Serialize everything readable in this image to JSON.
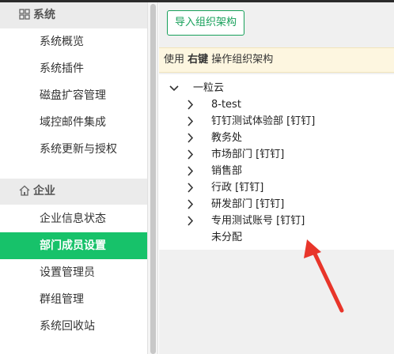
{
  "sidebar": {
    "system": {
      "header": "系统",
      "items": [
        "系统概览",
        "系统插件",
        "磁盘扩容管理",
        "域控邮件集成",
        "系统更新与授权"
      ]
    },
    "enterprise": {
      "header": "企业",
      "items": [
        "企业信息状态",
        "部门成员设置",
        "设置管理员",
        "群组管理",
        "系统回收站"
      ],
      "active_index": 1
    }
  },
  "main": {
    "import_button": "导入组织架构",
    "tip": {
      "prefix": "使用 ",
      "key": "右键",
      "suffix": " 操作组织架构"
    },
    "tree": {
      "root": "一粒云",
      "children": [
        "8-test",
        "钉钉测试体验部 [钉钉]",
        "教务处",
        "市场部门 [钉钉]",
        "销售部",
        "行政 [钉钉]",
        "研发部门 [钉钉]",
        "专用测试账号 [钉钉]",
        "未分配"
      ]
    }
  },
  "colors": {
    "accent": "#17c26a",
    "annotation_arrow": "#e8352a",
    "tip_bg": "#fdf6e0"
  },
  "icons": {
    "system": "grid-icon",
    "enterprise": "home-icon",
    "expand": "chevron-right-icon",
    "collapse": "chevron-down-icon"
  }
}
